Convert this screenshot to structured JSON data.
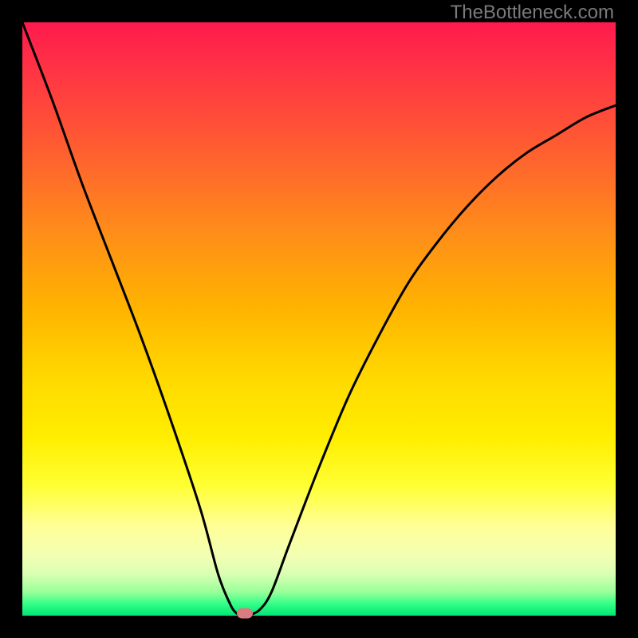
{
  "watermark": "TheBottleneck.com",
  "chart_data": {
    "type": "line",
    "title": "",
    "xlabel": "",
    "ylabel": "",
    "xlim": [
      0,
      100
    ],
    "ylim": [
      0,
      100
    ],
    "x": [
      0,
      5,
      10,
      15,
      20,
      25,
      30,
      33,
      35,
      36,
      37,
      38,
      40,
      42,
      45,
      50,
      55,
      60,
      65,
      70,
      75,
      80,
      85,
      90,
      95,
      100
    ],
    "values": [
      100,
      87,
      73,
      60,
      47,
      33,
      18,
      7,
      2,
      0.5,
      0,
      0,
      1,
      4,
      12,
      25,
      37,
      47,
      56,
      63,
      69,
      74,
      78,
      81,
      84,
      86
    ],
    "marker_point": {
      "x": 37.5,
      "y": 0
    },
    "gradient_description": "red-top-to-green-bottom"
  },
  "colors": {
    "curve": "#000000",
    "marker": "#d97b80",
    "frame": "#000000"
  }
}
